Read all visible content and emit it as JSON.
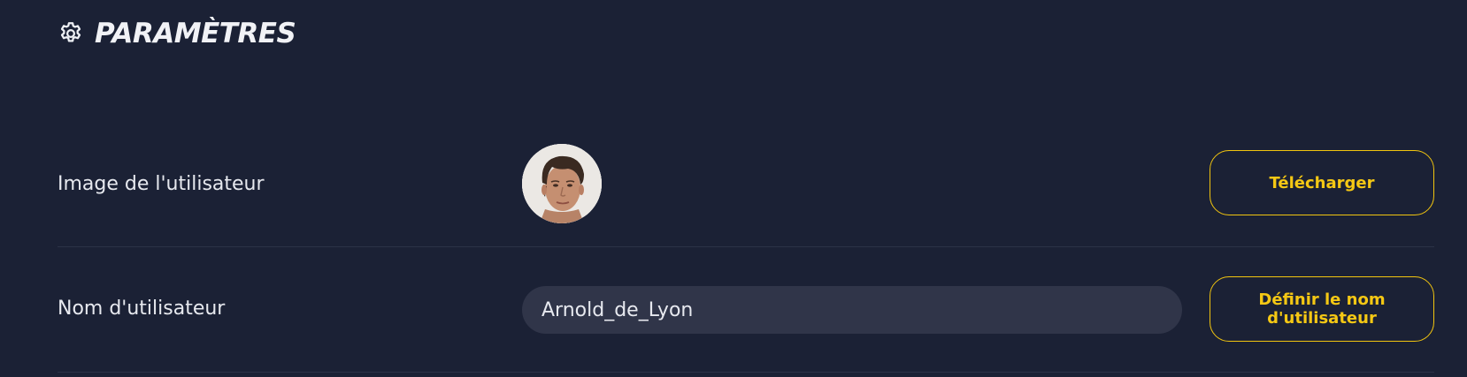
{
  "header": {
    "icon": "gear-icon",
    "title": "PARAMÈTRES"
  },
  "rows": [
    {
      "label": "Image de l'utilisateur",
      "avatar_alt": "avatar",
      "button_label": "Télécharger"
    },
    {
      "label": "Nom d'utilisateur",
      "input_value": "Arnold_de_Lyon",
      "button_label": "Définir le nom d'utilisateur"
    }
  ],
  "colors": {
    "background": "#1b2135",
    "accent": "#f5c814",
    "input_background": "#303549",
    "text": "#e7e9ef",
    "divider": "#2b3247"
  }
}
